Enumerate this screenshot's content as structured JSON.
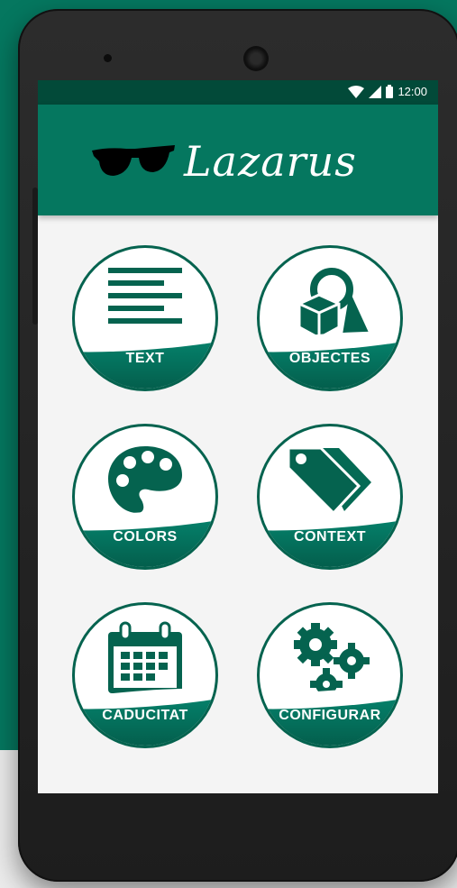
{
  "status_bar": {
    "time": "12:00",
    "icons": [
      "wifi-icon",
      "signal-icon",
      "battery-icon"
    ]
  },
  "app_bar": {
    "title": "Lazarus",
    "logo_icon": "sunglasses-icon"
  },
  "menu": [
    {
      "id": "text",
      "label": "TEXT",
      "icon": "text-lines-icon"
    },
    {
      "id": "objectes",
      "label": "OBJECTES",
      "icon": "shapes-icon"
    },
    {
      "id": "colors",
      "label": "COLORS",
      "icon": "palette-icon"
    },
    {
      "id": "context",
      "label": "CONTEXT",
      "icon": "tags-icon"
    },
    {
      "id": "caducitat",
      "label": "CADUCITAT",
      "icon": "calendar-icon"
    },
    {
      "id": "configurar",
      "label": "CONFIGURAR",
      "icon": "gears-icon"
    }
  ],
  "colors": {
    "primary": "#05775f",
    "primary_dark": "#024a39",
    "accent_dark": "#05634f",
    "background": "#f4f4f4"
  }
}
